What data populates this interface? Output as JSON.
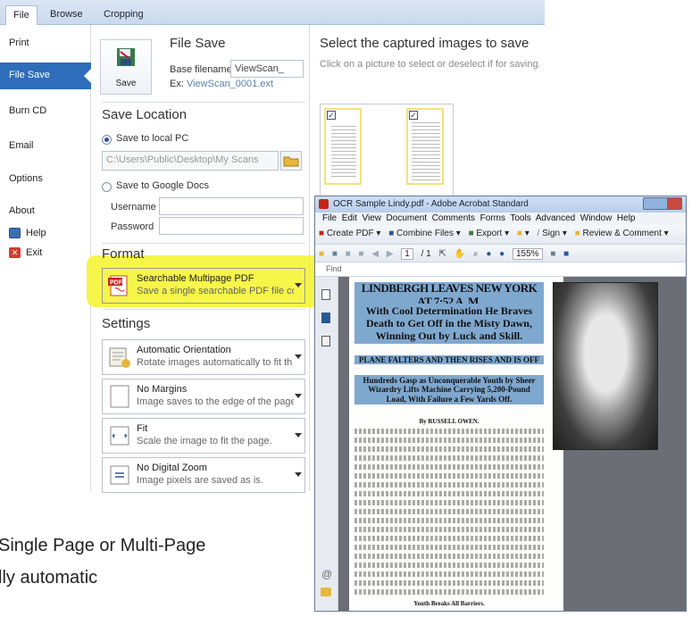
{
  "ribbon": {
    "tabs": [
      "File",
      "Browse",
      "Cropping"
    ]
  },
  "sidebar": {
    "items": [
      {
        "label": "Print"
      },
      {
        "label": "File Save"
      },
      {
        "label": "Burn CD"
      },
      {
        "label": "Email"
      },
      {
        "label": "Options"
      },
      {
        "label": "About"
      },
      {
        "label": "Help"
      },
      {
        "label": "Exit"
      }
    ]
  },
  "file_save": {
    "title": "File Save",
    "save_button": "Save",
    "base_filename_label": "Base filename:",
    "base_filename_value": "ViewScan_",
    "example_prefix": "Ex:",
    "example_value": "ViewScan_0001.ext"
  },
  "save_location": {
    "title": "Save Location",
    "local_option": "Save to local PC",
    "local_path": "C:\\Users\\Public\\Desktop\\My Scans",
    "google_option": "Save to Google Docs",
    "username_label": "Username",
    "password_label": "Password"
  },
  "format": {
    "title": "Format",
    "selected_title": "Searchable Multipage PDF",
    "selected_desc": "Save a single searchable PDF file con",
    "highlight_color": "#f4f32a"
  },
  "settings": {
    "title": "Settings",
    "items": [
      {
        "title": "Automatic Orientation",
        "desc": "Rotate images automatically to fit th"
      },
      {
        "title": "No Margins",
        "desc": "Image saves to the edge of the page"
      },
      {
        "title": "Fit",
        "desc": "Scale the image to fit the page."
      },
      {
        "title": "No Digital Zoom",
        "desc": "Image pixels are saved as is."
      }
    ]
  },
  "images_panel": {
    "title": "Select the captured images to save",
    "subtitle": "Click on a picture to select or deselect if for saving."
  },
  "acrobat": {
    "title": "OCR Sample Lindy.pdf - Adobe Acrobat Standard",
    "menu": [
      "File",
      "Edit",
      "View",
      "Document",
      "Comments",
      "Forms",
      "Tools",
      "Advanced",
      "Window",
      "Help"
    ],
    "toolbar": {
      "create_pdf": "Create PDF",
      "combine_files": "Combine Files",
      "export": "Export",
      "sign": "Sign",
      "review": "Review & Comment",
      "page_current": "1",
      "page_total": "/ 1",
      "zoom": "155%"
    },
    "find_label": "Find",
    "newspaper": {
      "headline": "LINDBERGH LEAVES NEW YORK AT 7:52 A. M.",
      "subhead": "With Cool Determination He Braves Death to Get Off in the Misty Dawn, Winning Out by Luck and Skill.",
      "banner": "PLANE FALTERS AND THEN RISES AND IS OFF",
      "deck": "Hundreds Gasp as Unconquerable Youth by Sheer Wizardry Lifts Machine Carrying 5,200-Pound Load, With Failure a Few Yards Off.",
      "byline": "By RUSSELL OWEN.",
      "footer": "Youth Breaks All Barriers."
    }
  },
  "caption": {
    "line1": "Single Page or Multi-Page",
    "line2": "lly automatic"
  }
}
